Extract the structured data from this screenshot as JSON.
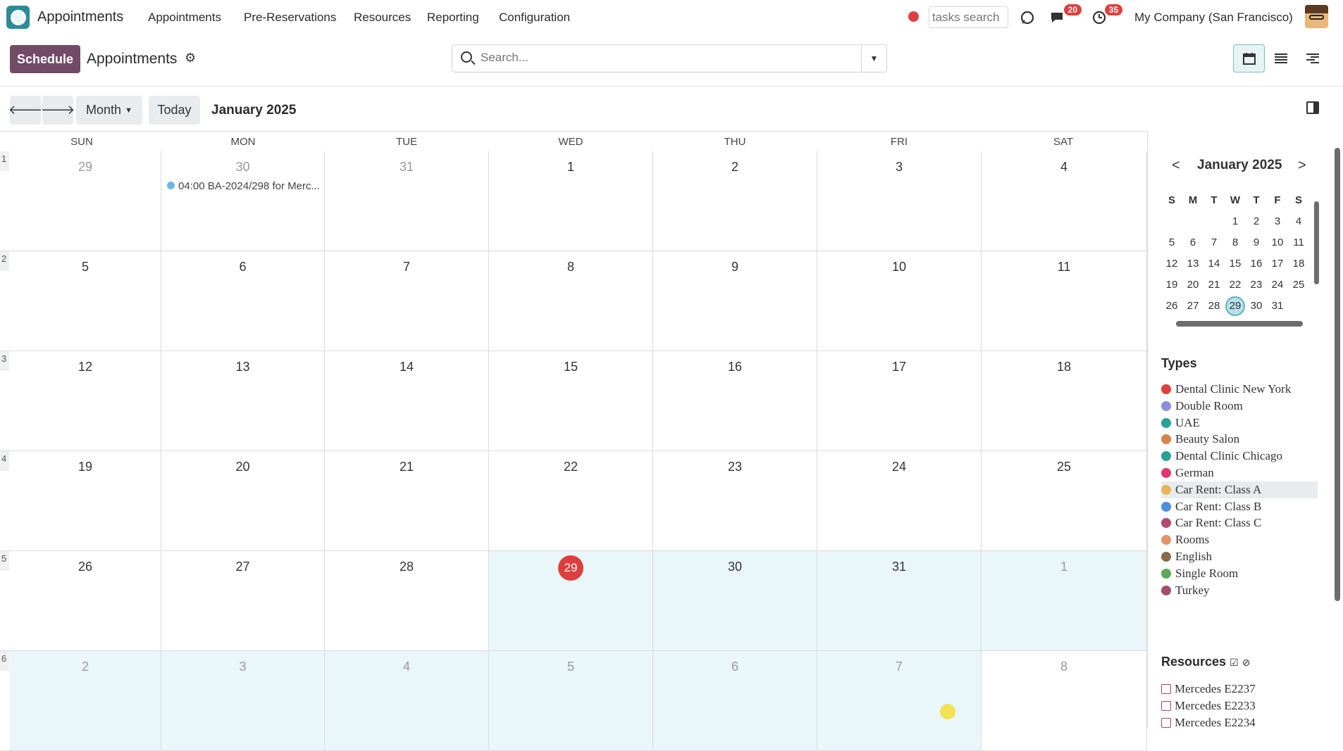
{
  "app": {
    "name": "Appointments"
  },
  "menu": [
    "Appointments",
    "Pre-Reservations",
    "Resources",
    "Reporting",
    "Configuration"
  ],
  "systray": {
    "tasks_search_placeholder": "tasks search",
    "messages_badge": "20",
    "activities_badge": "35",
    "company": "My Company (San Francisco)"
  },
  "control": {
    "schedule_label": "Schedule",
    "title": "Appointments",
    "search_placeholder": "Search..."
  },
  "nav": {
    "scale_label": "Month",
    "today_label": "Today",
    "period_label": "January 2025"
  },
  "calendar": {
    "weekdays": [
      "SUN",
      "MON",
      "TUE",
      "WED",
      "THU",
      "FRI",
      "SAT"
    ],
    "weeks": [
      {
        "num": "1",
        "days": [
          "29",
          "30",
          "31",
          "1",
          "2",
          "3",
          "4"
        ]
      },
      {
        "num": "2",
        "days": [
          "5",
          "6",
          "7",
          "8",
          "9",
          "10",
          "11"
        ]
      },
      {
        "num": "3",
        "days": [
          "12",
          "13",
          "14",
          "15",
          "16",
          "17",
          "18"
        ]
      },
      {
        "num": "4",
        "days": [
          "19",
          "20",
          "21",
          "22",
          "23",
          "24",
          "25"
        ]
      },
      {
        "num": "5",
        "days": [
          "26",
          "27",
          "28",
          "29",
          "30",
          "31",
          "1"
        ]
      },
      {
        "num": "6",
        "days": [
          "2",
          "3",
          "4",
          "5",
          "6",
          "7",
          "8"
        ]
      }
    ],
    "event": {
      "text": "04:00 BA-2024/298 for Merc...",
      "color": "#6bb6e4"
    },
    "today_color": "#e03e3e"
  },
  "mini_calendar": {
    "title": "January 2025",
    "headers": [
      "S",
      "M",
      "T",
      "W",
      "T",
      "F",
      "S"
    ],
    "rows": [
      [
        "",
        "",
        "",
        "1",
        "2",
        "3",
        "4"
      ],
      [
        "5",
        "6",
        "7",
        "8",
        "9",
        "10",
        "11"
      ],
      [
        "12",
        "13",
        "14",
        "15",
        "16",
        "17",
        "18"
      ],
      [
        "19",
        "20",
        "21",
        "22",
        "23",
        "24",
        "25"
      ],
      [
        "26",
        "27",
        "28",
        "29",
        "30",
        "31",
        ""
      ]
    ],
    "selected": "29"
  },
  "types": {
    "title": "Types",
    "items": [
      {
        "label": "Dental Clinic New York",
        "color": "#e03e3e"
      },
      {
        "label": "Double Room",
        "color": "#8e8ed6"
      },
      {
        "label": "UAE",
        "color": "#2aa198"
      },
      {
        "label": "Beauty Salon",
        "color": "#d9824b"
      },
      {
        "label": "Dental Clinic Chicago",
        "color": "#2aa198"
      },
      {
        "label": "German",
        "color": "#e0366d"
      },
      {
        "label": "Car Rent: Class A",
        "color": "#e8b45c"
      },
      {
        "label": "Car Rent: Class B",
        "color": "#4a90d9"
      },
      {
        "label": "Car Rent: Class C",
        "color": "#b04a73"
      },
      {
        "label": "Rooms",
        "color": "#e2936a"
      },
      {
        "label": "English",
        "color": "#8b6a4e"
      },
      {
        "label": "Single Room",
        "color": "#5aa85a"
      },
      {
        "label": "Turkey",
        "color": "#a34f6a"
      }
    ]
  },
  "resources": {
    "title": "Resources",
    "items": [
      "Mercedes E2237",
      "Mercedes E2233",
      "Mercedes E2234"
    ]
  }
}
